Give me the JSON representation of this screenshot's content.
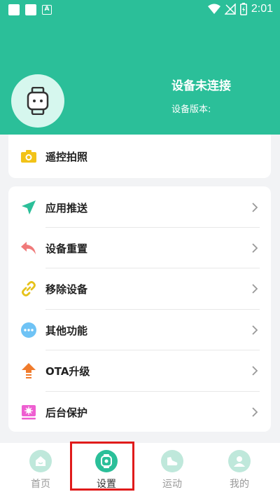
{
  "status": {
    "time": "2:01",
    "a_badge": "A"
  },
  "device": {
    "title": "设备未连接",
    "version_label": "设备版本:"
  },
  "card1": {
    "items": [
      {
        "label": "遥控拍照",
        "icon": "camera-icon"
      }
    ]
  },
  "card2": {
    "items": [
      {
        "label": "应用推送",
        "icon": "send-icon"
      },
      {
        "label": "设备重置",
        "icon": "reset-arrow-icon"
      },
      {
        "label": "移除设备",
        "icon": "unlink-icon"
      },
      {
        "label": "其他功能",
        "icon": "more-dots-icon"
      },
      {
        "label": "OTA升级",
        "icon": "upgrade-icon"
      },
      {
        "label": "后台保护",
        "icon": "protect-icon"
      }
    ]
  },
  "tabs": [
    {
      "label": "首页",
      "icon": "home-icon"
    },
    {
      "label": "设置",
      "icon": "watch-icon",
      "active": true
    },
    {
      "label": "运动",
      "icon": "shoe-icon"
    },
    {
      "label": "我的",
      "icon": "user-icon"
    }
  ],
  "colors": {
    "brand": "#2bbf99",
    "highlight": "#e01b1b"
  }
}
